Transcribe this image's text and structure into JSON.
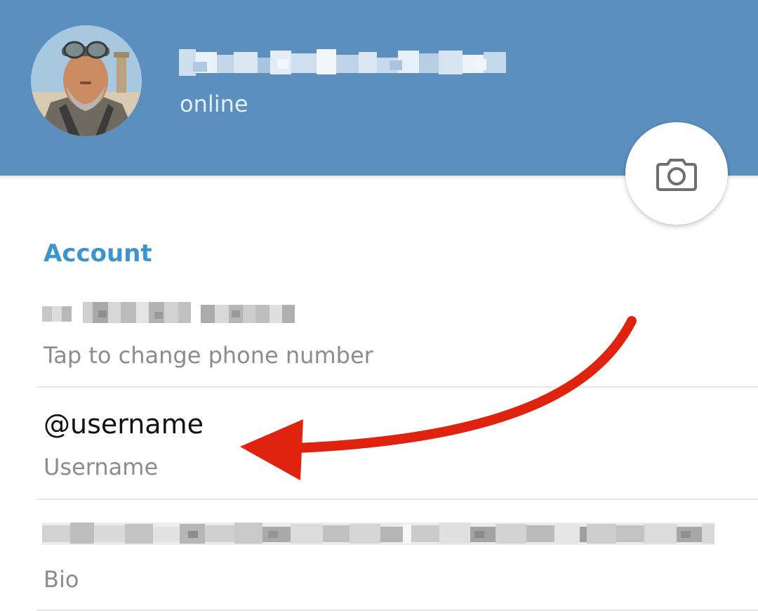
{
  "profile": {
    "status": "online",
    "name_redacted": true
  },
  "account_section": {
    "title": "Account",
    "phone": {
      "value_redacted": true,
      "subtitle": "Tap to change phone number"
    },
    "username": {
      "value": "@username",
      "subtitle": "Username"
    },
    "bio": {
      "value_redacted": true,
      "subtitle": "Bio"
    }
  },
  "icons": {
    "camera": "camera-icon",
    "annotation": "red-arrow"
  },
  "colors": {
    "header_bg": "#5a8fbe",
    "accent": "#3d95d0",
    "annotation_arrow": "#e0230e"
  }
}
